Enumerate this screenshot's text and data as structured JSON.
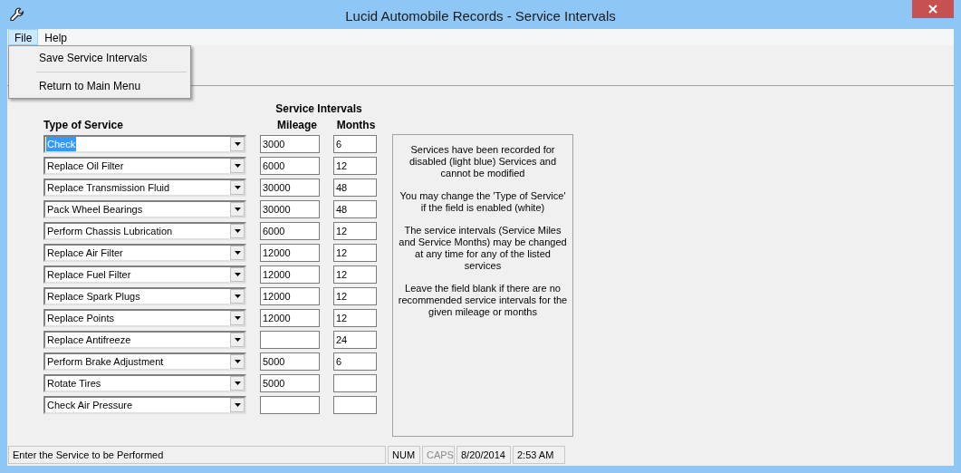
{
  "window": {
    "title": "Lucid Automobile Records - Service Intervals"
  },
  "menu_bar": [
    {
      "label": "File",
      "selected": true
    },
    {
      "label": "Help",
      "selected": false
    }
  ],
  "open_menu": {
    "items": [
      {
        "label": "Save Service Intervals"
      },
      {
        "label": "Return to Main Menu"
      }
    ]
  },
  "form": {
    "group_heading": "Service Intervals",
    "columns": [
      "Type of Service",
      "Mileage",
      "Months"
    ],
    "rows": [
      {
        "service": "Check",
        "highlighted": true,
        "mileage": "3000",
        "months": "6"
      },
      {
        "service": "Replace Oil Filter",
        "highlighted": false,
        "mileage": "6000",
        "months": "12"
      },
      {
        "service": "Replace Transmission Fluid",
        "highlighted": false,
        "mileage": "30000",
        "months": "48"
      },
      {
        "service": "Pack Wheel Bearings",
        "highlighted": false,
        "mileage": "30000",
        "months": "48"
      },
      {
        "service": "Perform Chassis Lubrication",
        "highlighted": false,
        "mileage": "6000",
        "months": "12"
      },
      {
        "service": "Replace Air Filter",
        "highlighted": false,
        "mileage": "12000",
        "months": "12"
      },
      {
        "service": "Replace Fuel Filter",
        "highlighted": false,
        "mileage": "12000",
        "months": "12"
      },
      {
        "service": "Replace Spark Plugs",
        "highlighted": false,
        "mileage": "12000",
        "months": "12"
      },
      {
        "service": "Replace Points",
        "highlighted": false,
        "mileage": "12000",
        "months": "12"
      },
      {
        "service": "Replace Antifreeze",
        "highlighted": false,
        "months": "24"
      },
      {
        "service": "Perform Brake Adjustment",
        "highlighted": false,
        "mileage": "5000",
        "months": "6"
      },
      {
        "service": "Rotate Tires",
        "highlighted": false,
        "mileage": "5000"
      },
      {
        "service": "Check Air Pressure",
        "highlighted": false
      }
    ]
  },
  "info_panel": [
    "Services have been recorded for disabled (light blue) Services and cannot be modified",
    "You may change the 'Type of Service' if the field is enabled (white)",
    "The service intervals (Service Miles and Service Months) may be changed at any time for any of the listed services",
    "Leave the field blank if there are no recommended service intervals for the given mileage or months"
  ],
  "status_bar": {
    "message": "Enter the Service to be Performed",
    "panels": [
      {
        "text": "NUM",
        "enabled": true
      },
      {
        "text": "CAPS",
        "enabled": false
      },
      {
        "text": "8/20/2014",
        "enabled": true
      },
      {
        "text": "2:53 AM",
        "enabled": true
      }
    ]
  }
}
